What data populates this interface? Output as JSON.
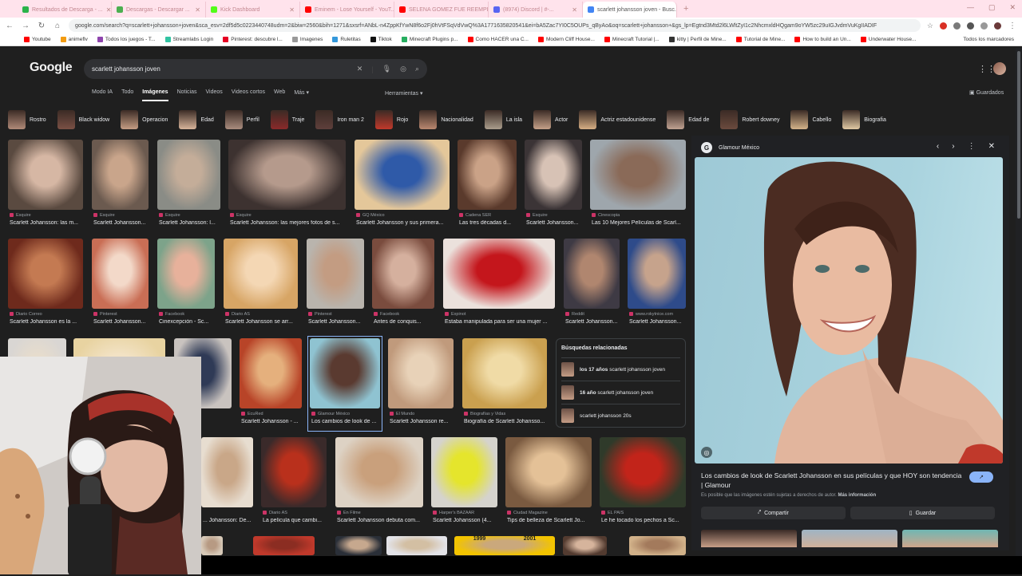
{
  "browser": {
    "tabs": [
      {
        "label": "Resultados de Descarga - ...",
        "color": "#2bb34a",
        "active": false
      },
      {
        "label": "Descargas - Descargar ...",
        "color": "#4caf50",
        "active": false
      },
      {
        "label": "Kick Dashboard",
        "color": "#53fc18",
        "active": false
      },
      {
        "label": "Eminem - Lose Yourself - YouT...",
        "color": "#ff0000",
        "active": false
      },
      {
        "label": "SELENA GOMEZ FUE REEMPL...",
        "color": "#ff0000",
        "active": false
      },
      {
        "label": "(8974) Discord | #-...",
        "color": "#5865f2",
        "active": false
      },
      {
        "label": "scarlett johansson joven - Busc...",
        "color": "#4285f4",
        "active": true
      }
    ],
    "new_tab": "+",
    "window_controls": [
      "—",
      "▢",
      "✕"
    ],
    "url": "google.com/search?q=scarlett+johansson+joven&sca_esv=2df5d5c0223440748udm=2&biw=2560&bih=1271&sxsrf=ANbL-n4ZppKfYwN8f6o2Fj0hVtFSqVdVwQ%3A1771635820541&ei=bA5Zac7YI0C5OUPs_qByAo&oq=scarlett+johansson+&gs_lp=Egtnd3Mtd2l6LWltZyI1c2NhcmxldHQgam9oYW5zc29uIGJvdmVuKgIIADIF",
    "bookmarks": [
      {
        "label": "Youtube",
        "color": "#ff0000"
      },
      {
        "label": "animeflv",
        "color": "#f39c12"
      },
      {
        "label": "Todos los juegos - T...",
        "color": "#8e44ad"
      },
      {
        "label": "Streamlabs Login",
        "color": "#31c3a2"
      },
      {
        "label": "Pinterest: descubre l...",
        "color": "#e60023"
      },
      {
        "label": "Imagenes",
        "color": "#999999"
      },
      {
        "label": "Ruletitas",
        "color": "#3498db"
      },
      {
        "label": "Tiktok",
        "color": "#111111"
      },
      {
        "label": "Minecraft Plugins p...",
        "color": "#27ae60"
      },
      {
        "label": "Como HACER una C...",
        "color": "#ff0000"
      },
      {
        "label": "Modern Cliff House...",
        "color": "#ff0000"
      },
      {
        "label": "Minecraft Tutorial |...",
        "color": "#ff0000"
      },
      {
        "label": "kitty | Perfil de Mine...",
        "color": "#333333"
      },
      {
        "label": "Tutorial de Mine...",
        "color": "#ff0000"
      },
      {
        "label": "How to build an Un...",
        "color": "#ff0000"
      },
      {
        "label": "Underwater House...",
        "color": "#ff0000"
      }
    ],
    "all_bookmarks": "Todos los marcadores"
  },
  "google": {
    "logo": "Google",
    "query": "scarlett johansson joven",
    "tabs": [
      "Modo IA",
      "Todo",
      "Imágenes",
      "Noticias",
      "Videos",
      "Videos cortos",
      "Web",
      "Más ▾"
    ],
    "active_tab": "Imágenes",
    "tools": "Herramientas ▾",
    "saved": "Guardados"
  },
  "chips": [
    {
      "label": "Rostro",
      "color": "#b08a78"
    },
    {
      "label": "Black widow",
      "color": "#7a5045"
    },
    {
      "label": "Operacion",
      "color": "#c59d84"
    },
    {
      "label": "Edad",
      "color": "#d7b49a"
    },
    {
      "label": "Perfil",
      "color": "#a98c7e"
    },
    {
      "label": "Traje",
      "color": "#8a2a2a"
    },
    {
      "label": "Iron man 2",
      "color": "#5e3f3b"
    },
    {
      "label": "Rojo",
      "color": "#c0392b"
    },
    {
      "label": "Nacionalidad",
      "color": "#b98870"
    },
    {
      "label": "La isla",
      "color": "#aa9d8c"
    },
    {
      "label": "Actor",
      "color": "#c4a088"
    },
    {
      "label": "Actriz estadounidense",
      "color": "#d6ae84"
    },
    {
      "label": "Edad de",
      "color": "#bfa191"
    },
    {
      "label": "Robert downey",
      "color": "#6b4b3e"
    },
    {
      "label": "Cabello",
      "color": "#d4b38a"
    },
    {
      "label": "Biografia",
      "color": "#e0c9a3"
    }
  ],
  "images": [
    {
      "source": "Esquire",
      "title": "Scarlett Johansson: las m...",
      "c1": "#5a4a40",
      "c2": "#d6b7a4"
    },
    {
      "source": "Esquire",
      "title": "Scarlett Johansson...",
      "c1": "#6b5a4f",
      "c2": "#c9a58b"
    },
    {
      "source": "Esquire",
      "title": "Scarlett Johansson: l...",
      "c1": "#8a8c86",
      "c2": "#c4ad99"
    },
    {
      "source": "Esquire",
      "title": "Scarlett Johansson: las mejores fotos de s...",
      "c1": "#3d3230",
      "c2": "#b59a8c"
    },
    {
      "source": "GQ México",
      "title": "Scarlett Johansson y sus primera...",
      "c1": "#e4c79a",
      "c2": "#2f5aa8"
    },
    {
      "source": "Cadena SER",
      "title": "Las tres décadas d...",
      "c1": "#5a3a2c",
      "c2": "#caa287"
    },
    {
      "source": "Esquire",
      "title": "Scarlett Johansson...",
      "c1": "#3b3436",
      "c2": "#d7c2b5"
    },
    {
      "source": "Cinescopia",
      "title": "Las 10 Mejores Películas de Scarl...",
      "c1": "#9ea6ac",
      "c2": "#8a6a58"
    },
    {
      "source": "Diario Correo",
      "title": "Scarlett Johansson es la ...",
      "c1": "#6e2a1c",
      "c2": "#c47a52"
    },
    {
      "source": "Pinterest",
      "title": "Scarlett Johansson...",
      "c1": "#c96e55",
      "c2": "#f3d9c9"
    },
    {
      "source": "Facebook",
      "title": "Cinexcepción - Sc...",
      "c1": "#7da38a",
      "c2": "#e7b19b"
    },
    {
      "source": "Diario AS",
      "title": "Scarlett Johansson se arr...",
      "c1": "#d7a565",
      "c2": "#f4d7b4"
    },
    {
      "source": "Pinterest",
      "title": "Scarlett Johansson...",
      "c1": "#b9b4ad",
      "c2": "#c39c82"
    },
    {
      "source": "Facebook",
      "title": "Antes de conquis...",
      "c1": "#7a4c3e",
      "c2": "#d5b09e"
    },
    {
      "source": "Expinot",
      "title": "Estaba manipulada para ser una mujer ...",
      "c1": "#ebe1dc",
      "c2": "#c4161c"
    },
    {
      "source": "Reddit",
      "title": "Scarlett Johansson...",
      "c1": "#3e3a44",
      "c2": "#b0866f"
    },
    {
      "source": "www.rokytnice.com",
      "title": "Scarlett Johansson...",
      "c1": "#2e4b8a",
      "c2": "#c6a38c"
    },
    {
      "source": "",
      "title": "",
      "c1": "#d9d6d3",
      "c2": "#e6dccd"
    },
    {
      "source": "",
      "title": "",
      "c1": "#e8d3a1",
      "c2": "#f2e2c4"
    },
    {
      "source": "",
      "title": "...son...",
      "c1": "#c9c3bf",
      "c2": "#2f3a56"
    },
    {
      "source": "EcuRed",
      "title": "Scarlett Johansson - ...",
      "c1": "#b84428",
      "c2": "#e5b07d"
    },
    {
      "source": "Glamour México",
      "title": "Los cambios de look de ...",
      "c1": "#8fc3d1",
      "c2": "#5a3a30"
    },
    {
      "source": "El Mundo",
      "title": "Scarlett Johansson re...",
      "c1": "#c09a7c",
      "c2": "#e8d2b8"
    },
    {
      "source": "Biografías y Vidas",
      "title": "Biografía de Scarlett Johansso...",
      "c1": "#caa04f",
      "c2": "#f0dba6"
    },
    {
      "source": "",
      "title": "... Johansson: De...",
      "c1": "#e7ddd0",
      "c2": "#c9a788"
    },
    {
      "source": "Diario AS",
      "title": "La película que cambi...",
      "c1": "#3a2a2a",
      "c2": "#b9301c"
    },
    {
      "source": "En Filme",
      "title": "Scarlett Johansson debuta com...",
      "c1": "#ddd2c4",
      "c2": "#c9a07c"
    },
    {
      "source": "Harper's BAZAAR",
      "title": "Scarlett Johansson (4...",
      "c1": "#d5d3cd",
      "c2": "#e5e52c"
    },
    {
      "source": "Ciudad Magazine",
      "title": "Tips de belleza de Scarlett Jo...",
      "c1": "#7a5a40",
      "c2": "#e4c197"
    },
    {
      "source": "EL PAÍS",
      "title": "Le he tocado los pechos a Sc...",
      "c1": "#2f3a2a",
      "c2": "#c2241a"
    },
    {
      "source": "",
      "title": "",
      "c1": "#d7c9b8",
      "c2": "#b79a83"
    },
    {
      "source": "",
      "title": "",
      "c1": "#c0392b",
      "c2": "#8b2d22"
    },
    {
      "source": "",
      "title": "",
      "c1": "#2a2f38",
      "c2": "#c6a88e"
    },
    {
      "source": "",
      "title": "",
      "c1": "#e3e3e8",
      "c2": "#d3bfa3"
    },
    {
      "source": "",
      "title": "",
      "c1": "#f3c400",
      "c2": "#caa87c"
    },
    {
      "source": "",
      "title": "",
      "c1": "#533b30",
      "c2": "#d6b49c"
    },
    {
      "source": "",
      "title": "",
      "c1": "#d1b189",
      "c2": "#a37a5c"
    }
  ],
  "year_labels": [
    "1999",
    "2001"
  ],
  "related": {
    "title": "Búsquedas relacionadas",
    "items": [
      {
        "bold": "los 17 años",
        "rest": " scarlett johansson joven"
      },
      {
        "bold": "16 año",
        "rest": " scarlett johansson joven"
      },
      {
        "bold": "",
        "rest": "scarlett johansson 20s"
      }
    ]
  },
  "preview": {
    "source": "Glamour México",
    "controls": [
      "‹",
      "›",
      "⋮",
      "✕"
    ],
    "title": "Los cambios de look de Scarlett Johansson en sus películas y que HOY son tendencia | Glamour",
    "visit_icon": "↗",
    "note": "Es posible que las imágenes estén sujetas a derechos de autor.",
    "note_link": "Más información",
    "share": "Compartir",
    "save": "Guardar"
  }
}
